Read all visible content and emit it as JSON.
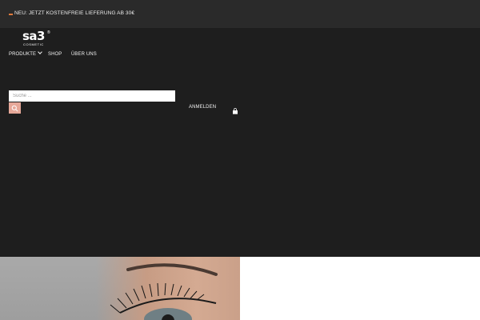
{
  "announcement": {
    "text": "NEU: JETZT KOSTENFREIE LIEFERUNG AB 30€",
    "accent_color": "#e07a3c"
  },
  "logo": {
    "main": "sa3",
    "registered": "®",
    "sub": "COSMETIC"
  },
  "nav": {
    "items": [
      {
        "label": "PRODUKTE",
        "has_dropdown": true
      },
      {
        "label": "SHOP"
      },
      {
        "label": "ÜBER UNS"
      }
    ]
  },
  "search": {
    "placeholder": "Suche ...",
    "button_icon": "search-icon",
    "button_color": "#e6a899"
  },
  "account": {
    "login_label": "ANMELDEN",
    "cart_icon": "shopping-bag-icon"
  },
  "colors": {
    "header_bg": "#1e1e1e",
    "announcement_bg": "#2a2a2a"
  }
}
